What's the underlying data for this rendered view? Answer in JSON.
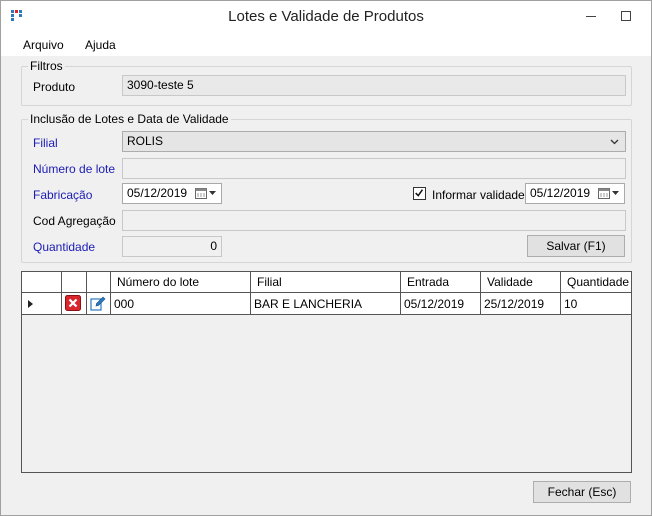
{
  "window": {
    "title": "Lotes e Validade de Produtos"
  },
  "menu": {
    "arquivo": "Arquivo",
    "ajuda": "Ajuda"
  },
  "filtros": {
    "title": "Filtros",
    "produto_label": "Produto",
    "produto_value": "3090-teste 5"
  },
  "inclusao": {
    "title": "Inclusão de Lotes e Data de Validade",
    "filial_label": "Filial",
    "filial_value": "ROLIS",
    "numero_lote_label": "Número de lote",
    "numero_lote_value": "",
    "fabricacao_label": "Fabricação",
    "fabricacao_value": "05/12/2019",
    "informar_validade_label": "Informar validade",
    "informar_validade_checked": true,
    "validade_value": "05/12/2019",
    "cod_agregacao_label": "Cod Agregação",
    "cod_agregacao_value": "",
    "quantidade_label": "Quantidade",
    "quantidade_value": "0",
    "salvar_label": "Salvar (F1)"
  },
  "grid": {
    "columns": [
      "Número do lote",
      "Filial",
      "Entrada",
      "Validade",
      "Quantidade"
    ],
    "rows": [
      {
        "numero_lote": "000",
        "filial": "BAR E LANCHERIA",
        "entrada": "05/12/2019",
        "validade": "25/12/2019",
        "quantidade": "10"
      }
    ]
  },
  "footer": {
    "fechar_label": "Fechar (Esc)"
  },
  "icons": {
    "app": "app-logo-icon",
    "delete": "delete-icon",
    "edit": "edit-icon",
    "calendar": "calendar-icon",
    "row_pointer": "row-pointer-icon"
  },
  "colors": {
    "label_blue": "#1b1bb5",
    "delete_red": "#d9262c",
    "edit_blue": "#2a7ac0"
  }
}
